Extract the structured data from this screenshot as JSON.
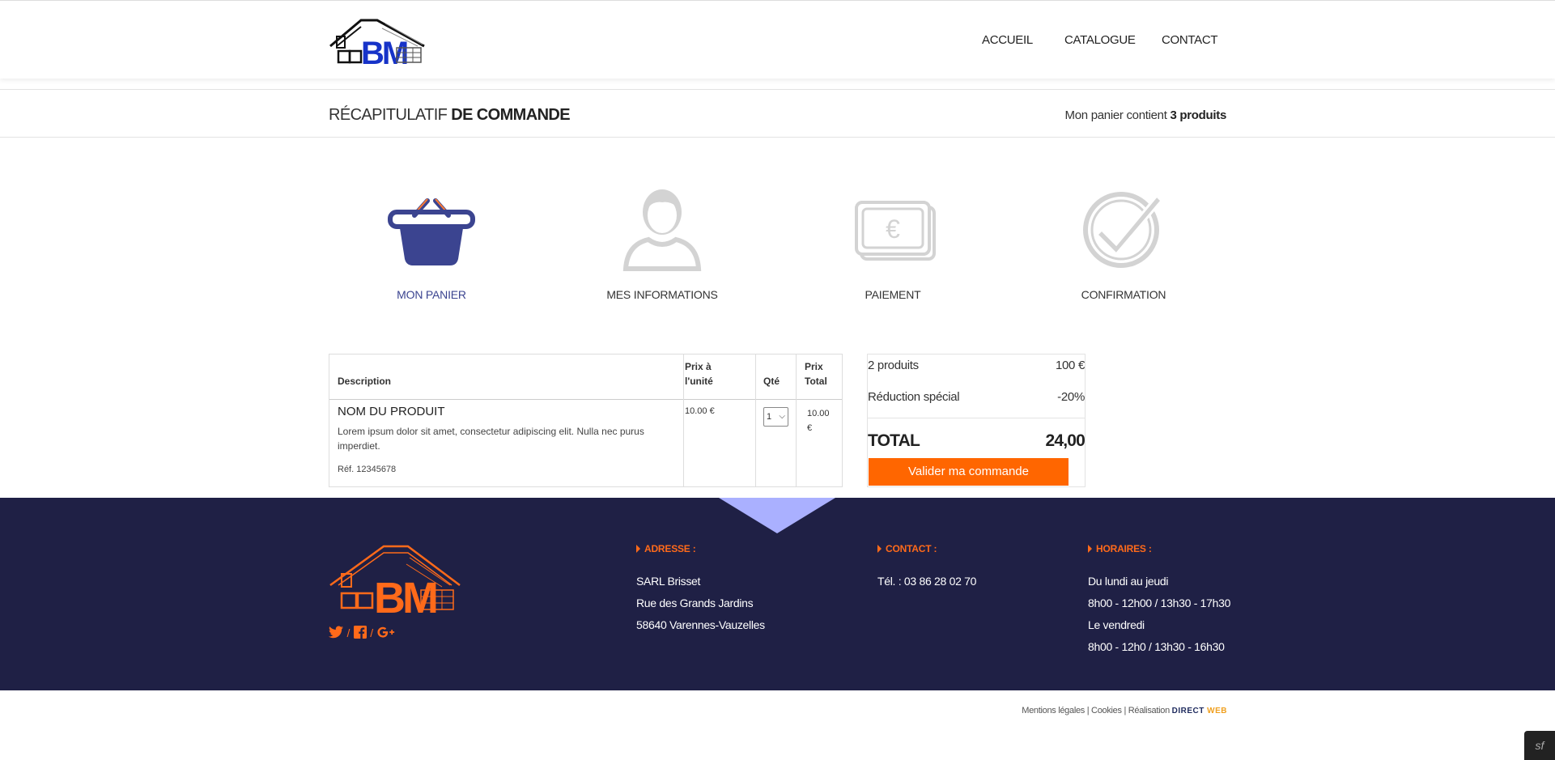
{
  "header": {
    "nav": [
      "ACCUEIL",
      "CATALOGUE",
      "CONTACT"
    ],
    "logo_letters": "BM"
  },
  "title_band": {
    "title_light": "RÉCAPITULATIF",
    "title_bold": "DE COMMANDE",
    "cart_prefix": "Mon panier contient",
    "cart_count": "3 produits"
  },
  "steps": [
    {
      "label": "MON PANIER",
      "icon": "basket-icon",
      "active": true
    },
    {
      "label": "MES INFORMATIONS",
      "icon": "user-icon",
      "active": false
    },
    {
      "label": "PAIEMENT",
      "icon": "euro-banknote-icon",
      "active": false
    },
    {
      "label": "CONFIRMATION",
      "icon": "check-circle-icon",
      "active": false
    }
  ],
  "cart_table": {
    "headers": {
      "description": "Description",
      "unit_price_1": "Prix à",
      "unit_price_2": "l'unité",
      "qty": "Qté",
      "total_1": "Prix",
      "total_2": "Total"
    },
    "rows": [
      {
        "name": "NOM DU PRODUIT",
        "description": "Lorem ipsum dolor sit amet, consectetur adipiscing elit. Nulla nec purus imperdiet.",
        "ref": "Réf. 12345678",
        "unit_price": "10.00 €",
        "qty": "1",
        "total_1": "10.00",
        "total_2": "€"
      }
    ]
  },
  "summary": {
    "products_label": "2 produits",
    "products_value": "100 €",
    "discount_label": "Réduction spécial",
    "discount_value": "-20%",
    "total_label": "TOTAL",
    "total_value": "24,00",
    "validate_label": "Valider ma commande"
  },
  "footer": {
    "address": {
      "heading": "ADRESSE :",
      "lines": [
        "SARL Brisset",
        "Rue des Grands Jardins",
        "58640 Varennes-Vauzelles"
      ]
    },
    "contact": {
      "heading": "CONTACT :",
      "lines": [
        "Tél. : 03 86 28 02 70"
      ]
    },
    "hours": {
      "heading": "HORAIRES :",
      "lines": [
        "Du lundi au jeudi",
        "8h00 - 12h00 / 13h30 - 17h30",
        "Le vendredi",
        "8h00 - 12h0 / 13h30 - 16h30"
      ]
    },
    "social_sep": "/"
  },
  "bottom": {
    "legal": "Mentions légales | Cookies | Réalisation",
    "brand_1": "DIRECT ",
    "brand_2": "WEB",
    "sf": "sf"
  },
  "colors": {
    "accent": "#ff6600",
    "footer_bg": "#1f2045",
    "active_step": "#3b4490",
    "inactive_step": "#d0d0d0"
  }
}
